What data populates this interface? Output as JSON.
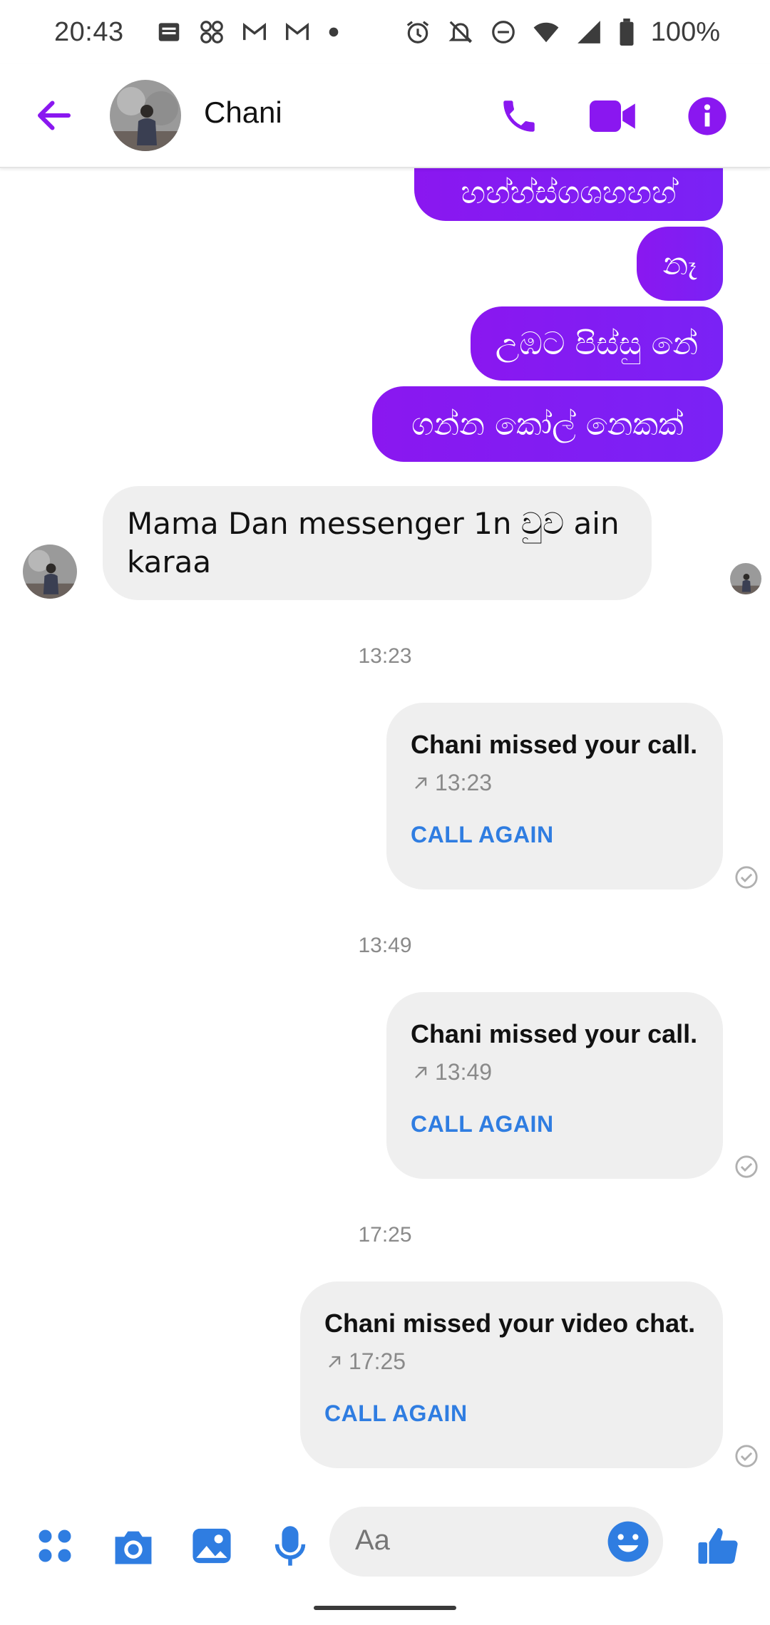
{
  "status_bar": {
    "time": "20:43",
    "battery": "100%",
    "left_icons": [
      "message-icon",
      "apps-icon",
      "gmail-icon",
      "gmail-icon",
      "dot-icon"
    ],
    "right_icons": [
      "alarm-icon",
      "notifications-off-icon",
      "do-not-disturb-icon",
      "wifi-icon",
      "signal-icon",
      "battery-icon"
    ]
  },
  "header": {
    "contact_name": "Chani",
    "icons": [
      "back-arrow-icon",
      "phone-icon",
      "video-icon",
      "info-icon"
    ]
  },
  "messages_out": [
    {
      "text": "හහ්හ්ස්ගශහහහ්"
    },
    {
      "text": "නෑ"
    },
    {
      "text": "උඹට පිස්සු නේ"
    },
    {
      "text": "ගන්න කෝල් නෙකක්"
    }
  ],
  "message_in": {
    "text": "Mama Dan messenger 1n වුව ain karaa"
  },
  "calls": [
    {
      "timestamp": "13:23",
      "title": "Chani missed your call.",
      "time": "13:23",
      "action": "CALL AGAIN"
    },
    {
      "timestamp": "13:49",
      "title": "Chani missed your call.",
      "time": "13:49",
      "action": "CALL AGAIN"
    },
    {
      "timestamp": "17:25",
      "title": "Chani missed your video chat.",
      "time": "17:25",
      "action": "CALL AGAIN"
    }
  ],
  "composer": {
    "placeholder": "Aa",
    "icons": [
      "apps-icon",
      "camera-icon",
      "gallery-icon",
      "microphone-icon",
      "emoji-icon",
      "like-icon"
    ]
  },
  "colors": {
    "accent": "#8a17f0",
    "link_blue": "#2f7de1",
    "bubble_gray": "#efefef"
  }
}
